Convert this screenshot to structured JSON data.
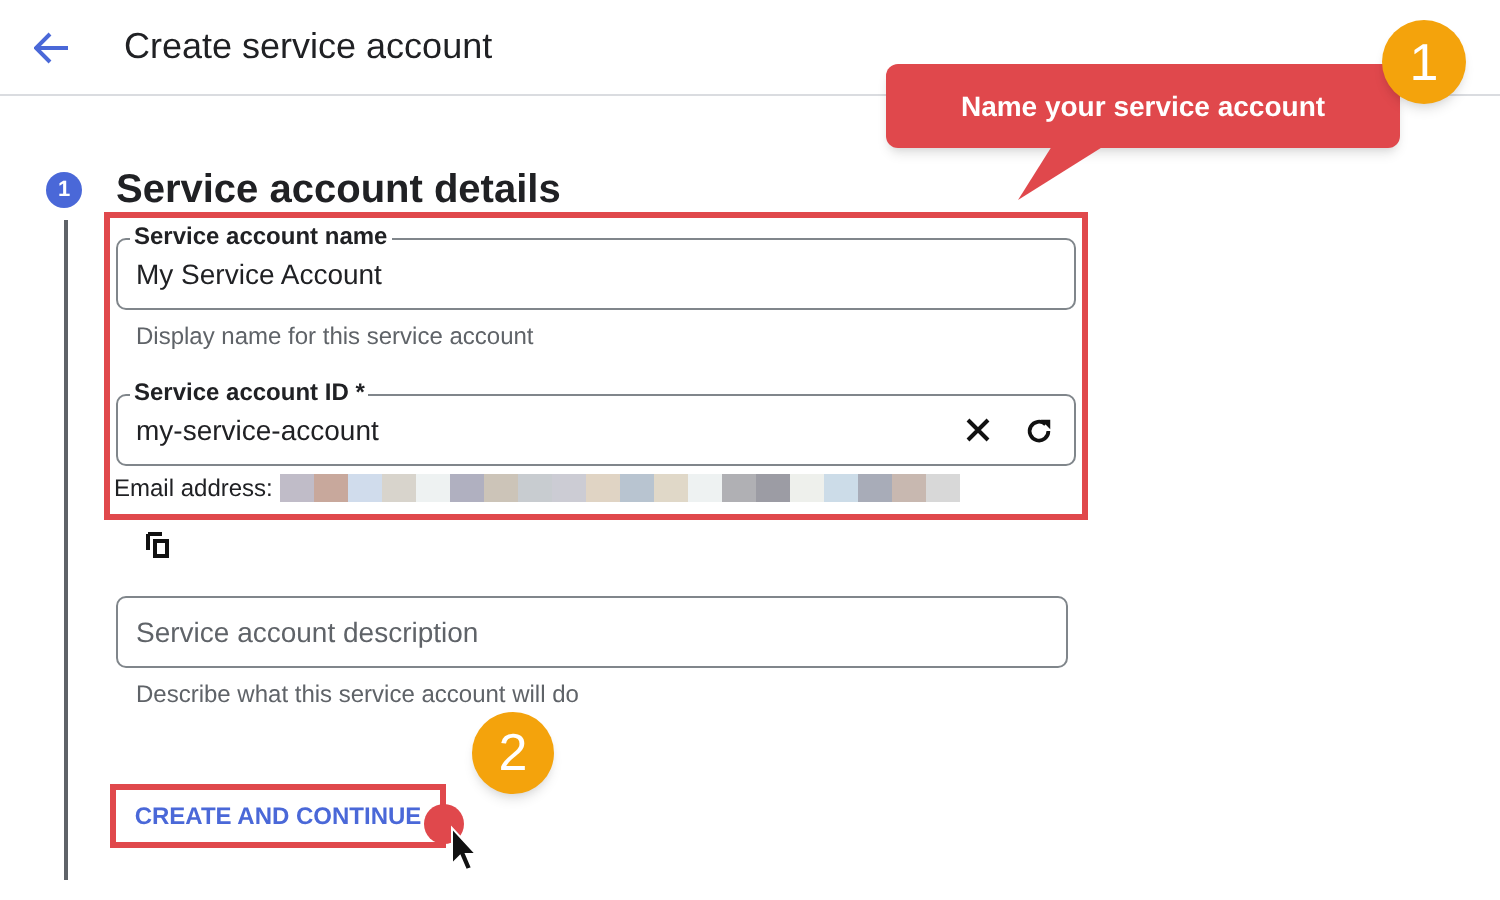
{
  "header": {
    "title": "Create service account"
  },
  "step": {
    "number": "1",
    "title": "Service account details"
  },
  "fields": [
    {
      "label": "Service account name",
      "value": "My Service Account",
      "helper": "Display name for this service account"
    },
    {
      "label": "Service account ID *",
      "value": "my-service-account"
    }
  ],
  "email": {
    "label": "Email address:"
  },
  "description_field": {
    "placeholder": "Service account description",
    "helper": "Describe what this service account will do"
  },
  "button": "CREATE AND CONTINUE",
  "annotations": [
    {
      "badge": "1",
      "callout": "Name your service account"
    },
    {
      "badge": "2"
    }
  ]
}
